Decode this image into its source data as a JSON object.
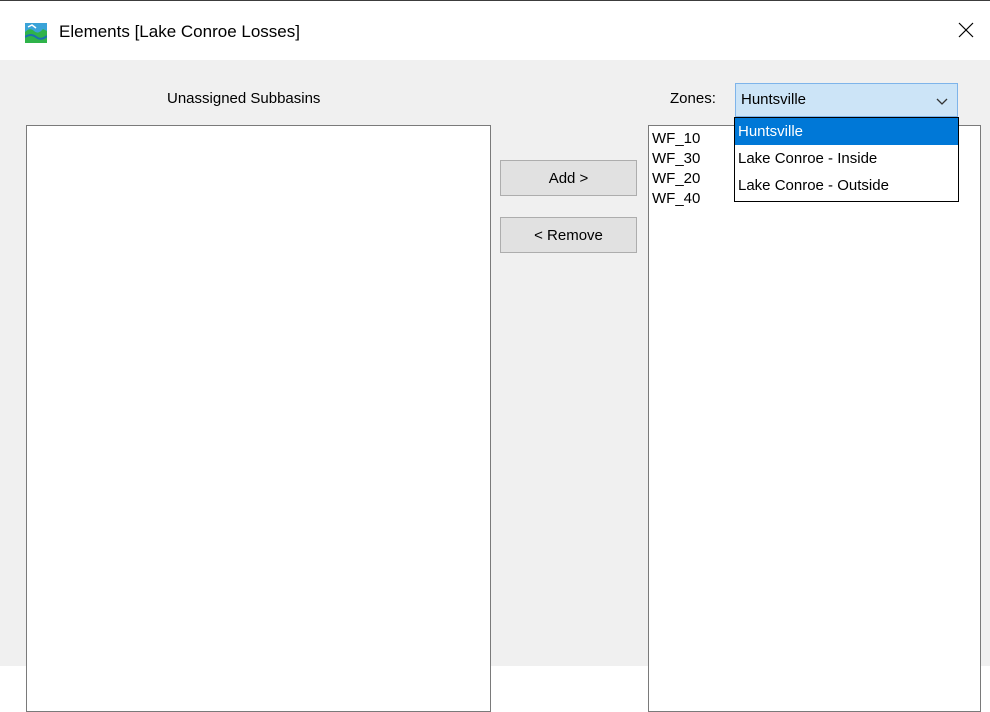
{
  "window": {
    "title": "Elements [Lake Conroe Losses]",
    "close_glyph": "✕"
  },
  "unassigned": {
    "label": "Unassigned Subbasins",
    "items": []
  },
  "buttons": {
    "add_label": "Add >",
    "remove_label": "< Remove"
  },
  "zones": {
    "label": "Zones:",
    "selected": "Huntsville",
    "options": [
      "Huntsville",
      "Lake Conroe - Inside",
      "Lake Conroe - Outside"
    ],
    "highlighted_index": 0
  },
  "assigned": {
    "items": [
      "WF_10",
      "WF_30",
      "WF_20",
      "WF_40"
    ]
  },
  "colors": {
    "selection": "#0078d7",
    "combo_bg": "#cce4f7",
    "combo_border": "#7eb4ea",
    "dialog_bg": "#f0f0f0"
  },
  "icons": {
    "app": "hec-hms-basin-icon",
    "close": "close-icon",
    "dropdown": "chevron-down-icon"
  }
}
